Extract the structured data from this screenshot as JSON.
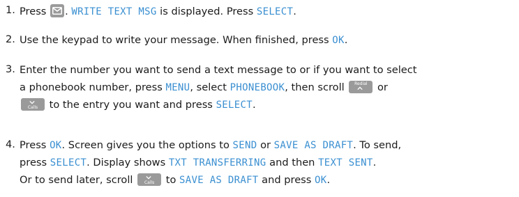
{
  "steps": [
    {
      "number": "1.",
      "parts": {
        "t1": "Press ",
        "t2": ". ",
        "d1": "WRITE TEXT MSG",
        "t3": " is displayed. Press ",
        "d2": "SELECT",
        "t4": "."
      }
    },
    {
      "number": "2.",
      "parts": {
        "t1": "Use the keypad to write your message. When finished, press ",
        "d1": "OK",
        "t2": "."
      }
    },
    {
      "number": "3.",
      "parts": {
        "t1": "Enter the number you want to send a text message to or if you want to select",
        "t2": "a phonebook number, press ",
        "d1": "MENU",
        "t3": ", select ",
        "d2": "PHONEBOOK",
        "t4": ", then scroll ",
        "t5": " or",
        "t6": " to the entry you want and press ",
        "d3": "SELECT",
        "t7": "."
      }
    },
    {
      "number": "4.",
      "parts": {
        "t1": "Press ",
        "d1": "OK",
        "t2": ". Screen gives you the options to ",
        "d2": "SEND",
        "t3": " or ",
        "d3": "SAVE AS DRAFT",
        "t4": ". To send,",
        "t5": "press ",
        "d4": "SELECT",
        "t6": ". Display shows ",
        "d5": "TXT TRANSFERRING",
        "t7": " and then ",
        "d6": "TEXT SENT",
        "t8": ".",
        "t9": "Or to send later, scroll ",
        "t10": " to ",
        "d7": "SAVE AS DRAFT",
        "t11": " and press ",
        "d8": "OK",
        "t12": "."
      }
    }
  ],
  "keys": {
    "redial": "Redial",
    "calls": "Calls",
    "message_icon": "envelope-icon",
    "up_icon": "chevron-up-icon",
    "down_icon": "chevron-down-icon"
  },
  "colors": {
    "text": "#1b1b1b",
    "display_text": "#3a8fd1",
    "key_background": "#9a9a9a"
  }
}
